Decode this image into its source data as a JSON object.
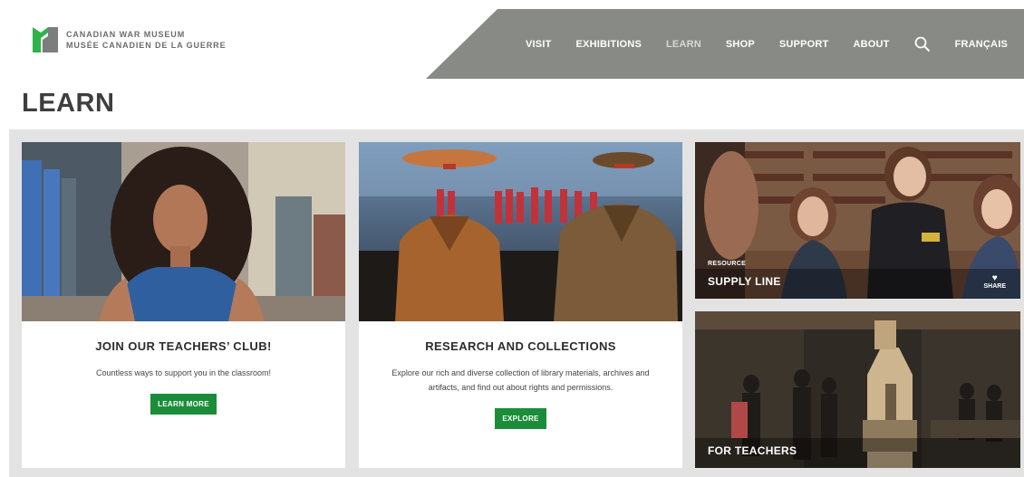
{
  "logo": {
    "line1": "CANADIAN WAR MUSEUM",
    "line2": "MUSÉE CANADIEN DE LA GUERRE",
    "colors": {
      "green": "#2db34a",
      "gray": "#7d7d7d"
    }
  },
  "nav": {
    "items": [
      {
        "label": "VISIT"
      },
      {
        "label": "EXHIBITIONS"
      },
      {
        "label": "LEARN",
        "active": true
      },
      {
        "label": "SHOP"
      },
      {
        "label": "SUPPORT"
      },
      {
        "label": "ABOUT"
      }
    ],
    "search_icon": "search-icon",
    "language": "FRANÇAIS"
  },
  "page": {
    "title": "LEARN"
  },
  "cards": [
    {
      "title": "JOIN OUR TEACHERS’ CLUB!",
      "description": "Countless ways to support you in the classroom!",
      "button": "LEARN MORE"
    },
    {
      "title": "RESEARCH AND COLLECTIONS",
      "description": "Explore our rich and diverse collection of library materials, archives and artifacts, and find out about rights and permissions.",
      "button": "EXPLORE"
    }
  ],
  "tiles": [
    {
      "eyebrow": "RESOURCE",
      "title": "SUPPLY LINE",
      "share": "SHARE"
    },
    {
      "title": "FOR TEACHERS"
    }
  ],
  "colors": {
    "accent": "#1b8d3a",
    "nav_bg": "#888a86",
    "content_bg": "#e3e3e3"
  }
}
